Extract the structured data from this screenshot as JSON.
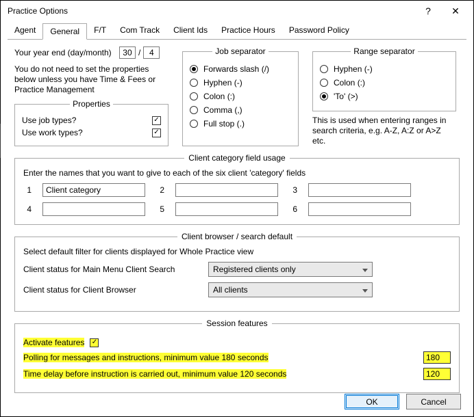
{
  "window": {
    "title": "Practice Options"
  },
  "tabs": [
    "Agent",
    "General",
    "F/T",
    "Com Track",
    "Client Ids",
    "Practice Hours",
    "Password Policy"
  ],
  "activeTab": "General",
  "year": {
    "label": "Your year end (day/month)",
    "day": "30",
    "month": "4",
    "note": "You do not need to set the properties below unless you have Time & Fees or Practice Management"
  },
  "props": {
    "legend": "Properties",
    "jobLabel": "Use job types?",
    "workLabel": "Use work types?"
  },
  "jobSep": {
    "legend": "Job separator",
    "opts": {
      "fslash": "Forwards slash (/)",
      "hyphen": "Hyphen (-)",
      "colon": "Colon (:)",
      "comma": "Comma (,)",
      "stop": "Full stop (.)"
    },
    "selected": "fslash"
  },
  "rangeSep": {
    "legend": "Range separator",
    "opts": {
      "hyphen": "Hyphen (-)",
      "colon": "Colon (:)",
      "to": "'To' (>)"
    },
    "selected": "to",
    "note": "This is used when entering ranges in search criteria, e.g. A-Z, A:Z or A>Z etc."
  },
  "cats": {
    "legend": "Client category field usage",
    "info": "Enter the names that you want to give to each of the six client 'category' fields",
    "vals": {
      "1": "Client category",
      "2": "",
      "3": "",
      "4": "",
      "5": "",
      "6": ""
    }
  },
  "browser": {
    "legend": "Client browser / search default",
    "info": "Select default filter for clients displayed for Whole Practice view",
    "row1Label": "Client status for Main Menu Client Search",
    "row1Value": "Registered clients only",
    "row2Label": "Client status for Client Browser",
    "row2Value": "All clients"
  },
  "session": {
    "legend": "Session features",
    "actLabel": "Activate features",
    "pollLabel": "Polling for messages and instructions, minimum value 180 seconds",
    "pollValue": "180",
    "delayLabel": "Time delay before instruction is carried out, minimum value 120 seconds",
    "delayValue": "120"
  },
  "buttons": {
    "ok": "OK",
    "cancel": "Cancel"
  }
}
